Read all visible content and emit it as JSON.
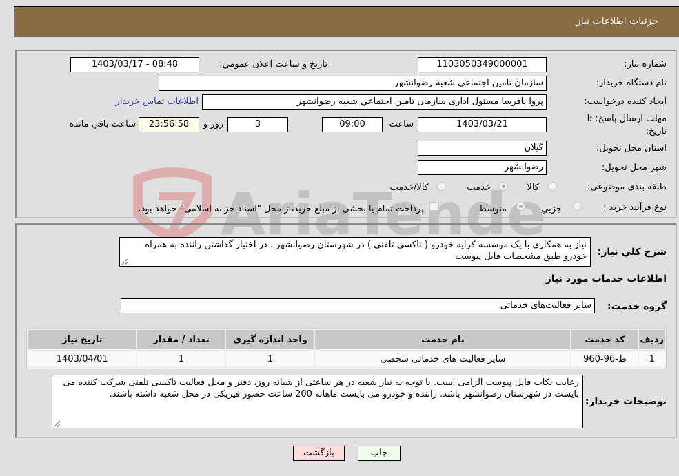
{
  "header": {
    "title": "جزئیات اطلاعات نیاز"
  },
  "form": {
    "need_number": {
      "label": "شماره نیاز:",
      "value": "1103050349000001"
    },
    "announce_datetime": {
      "label": "تاریخ و ساعت اعلان عمومي:",
      "value": "1403/03/17 - 08:48"
    },
    "buyer_org": {
      "label": "نام دستگاه خريدار:",
      "value": "سازمان تامين اجتماعي شعبه رضوانشهر"
    },
    "creator": {
      "label": "ایجاد کننده درخواست:",
      "value": "پروا بافرسا مسئول اداری سازمان تامين اجتماعي شعبه رضوانشهر"
    },
    "contact_link": "اطلاعات تماس خريدار",
    "deadline": {
      "label_line1": "مهلت ارسال پاسخ: تا",
      "label_line2": "تاریخ:",
      "date": "1403/03/21",
      "time_label": "ساعت",
      "time": "09:00",
      "days": "3",
      "days_label": "روز و",
      "remaining": "23:56:58",
      "remaining_label": "ساعت باقي مانده"
    },
    "province": {
      "label": "استان محل تحويل:",
      "value": "گيلان"
    },
    "city": {
      "label": "شهر محل تحويل:",
      "value": "رضوانشهر"
    },
    "category": {
      "label": "طبقه بندی موضوعی:",
      "options": [
        "کالا",
        "خدمت",
        "کالا/خدمت"
      ],
      "selected": "خدمت"
    },
    "purchase_type": {
      "label": "نوع فرآيند خريد :",
      "options": [
        "جزيي",
        "متوسط"
      ],
      "selected": "متوسط",
      "treasury_note": "پرداخت تمام يا بخشی از مبلغ خريد،از محل \"اسناد خزانه اسلامی\" خواهد بود."
    }
  },
  "description": {
    "label": "شرح کلي نياز:",
    "value": "نیاز به همکاری با یک موسسه کرایه خودرو ( تاکسی تلفنی ) در شهرستان رضوانشهر . در اختیار گذاشتن راننده به همراه خودرو طبق مشخصات فایل پیوست"
  },
  "services": {
    "section_title": "اطلاعات خدمات مورد نياز",
    "group_label": "گروه خدمت:",
    "group_value": "ساير فعاليت‌هاى خدماتى",
    "table": {
      "headers": [
        "رديف",
        "کد خدمت",
        "نام خدمت",
        "واحد اندازه گيری",
        "تعداد / مقدار",
        "تاريخ نياز"
      ],
      "rows": [
        [
          "1",
          "ط-96-960",
          "ساير فعاليت هاى خدماتى شخصى",
          "1",
          "1",
          "1403/04/01"
        ]
      ]
    }
  },
  "buyer_notes": {
    "label": "توضيحات خريدار:",
    "value": "رعایت نکات فایل پیوست الزامی است. با توجه به نیاز شعبه در هر ساعتی از شبانه روز، دفتر و محل فعالیت تاکسی تلفنی شرکت کننده می بایست در شهرستان رضوانشهر باشد. راننده و خودرو می بایست ماهانه 200 ساعت حضور فیزیکی در محل شعبه داشته باشند."
  },
  "buttons": {
    "print": "چاپ",
    "back": "بازگشت"
  },
  "watermark": "AriaTender.neT",
  "colors": {
    "header": "#8b6d45",
    "print_bg": "#eeffee",
    "back_bg": "#ffdddd",
    "link": "#2a34c6"
  }
}
